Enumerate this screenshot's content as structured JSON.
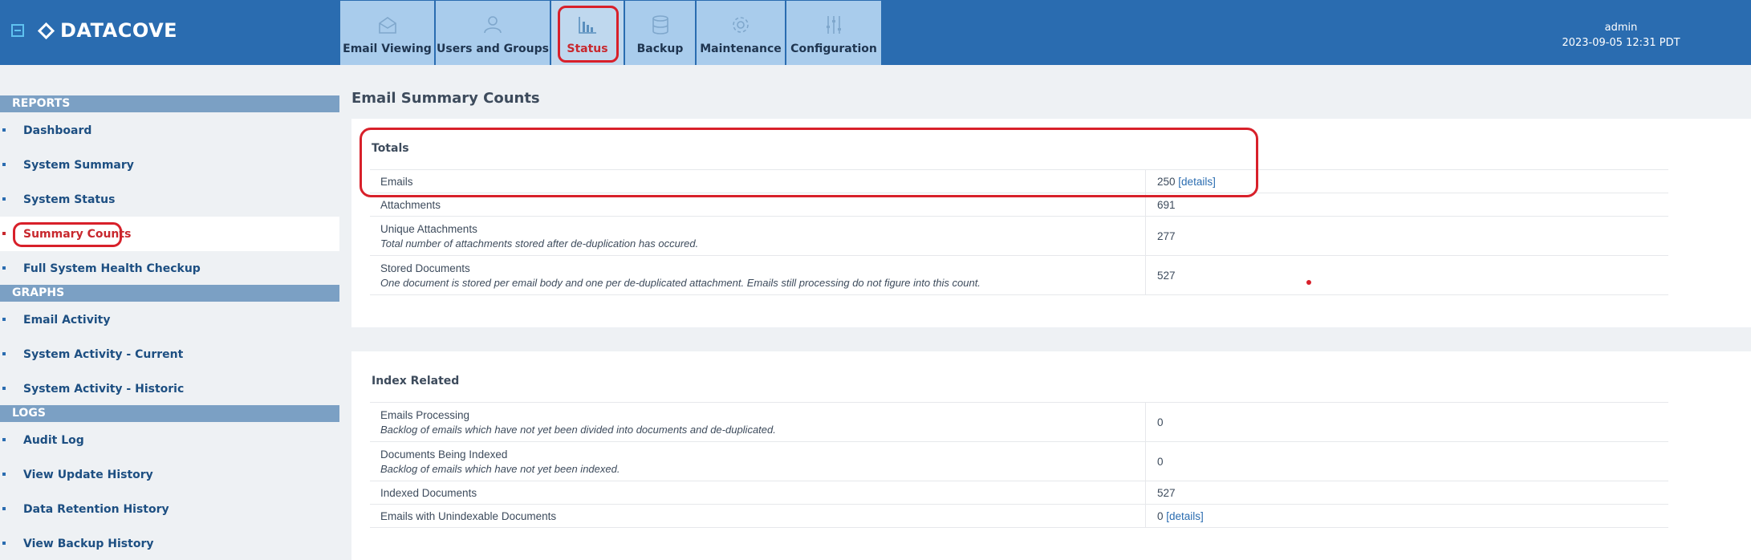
{
  "header": {
    "brand": "DATACOVE",
    "user": "admin",
    "datetime": "2023-09-05 12:31 PDT",
    "tabs": [
      {
        "label": "Email Viewing",
        "icon": "envelope-icon"
      },
      {
        "label": "Users and Groups",
        "icon": "users-icon"
      },
      {
        "label": "Status",
        "icon": "bar-chart-icon",
        "active": true
      },
      {
        "label": "Backup",
        "icon": "database-icon"
      },
      {
        "label": "Maintenance",
        "icon": "gear-icon"
      },
      {
        "label": "Configuration",
        "icon": "sliders-icon"
      }
    ]
  },
  "sidebar": {
    "reports_header": "REPORTS",
    "reports": [
      "Dashboard",
      "System Summary",
      "System Status",
      "Summary Counts",
      "Full System Health Checkup"
    ],
    "graphs_header": "GRAPHS",
    "graphs": [
      "Email Activity",
      "System Activity - Current",
      "System Activity - Historic"
    ],
    "logs_header": "LOGS",
    "logs": [
      "Audit Log",
      "View Update History",
      "Data Retention History",
      "View Backup History"
    ],
    "active_item": "Summary Counts"
  },
  "main": {
    "title": "Email Summary Counts",
    "totals": {
      "title": "Totals",
      "rows": [
        {
          "label": "Emails",
          "value": "250",
          "link": "[details]"
        },
        {
          "label": "Attachments",
          "value": "691"
        },
        {
          "label": "Unique Attachments",
          "desc": "Total number of attachments stored after de-duplication has occured.",
          "value": "277"
        },
        {
          "label": "Stored Documents",
          "desc": "One document is stored per email body and one per de-duplicated attachment. Emails still processing do not figure into this count.",
          "value": "527"
        }
      ]
    },
    "index": {
      "title": "Index Related",
      "rows": [
        {
          "label": "Emails Processing",
          "desc": "Backlog of emails which have not yet been divided into documents and de-duplicated.",
          "value": "0"
        },
        {
          "label": "Documents Being Indexed",
          "desc": "Backlog of emails which have not yet been indexed.",
          "value": "0"
        },
        {
          "label": "Indexed Documents",
          "value": "527"
        },
        {
          "label": "Emails with Unindexable Documents",
          "value": "0",
          "link": "[details]"
        }
      ]
    }
  }
}
